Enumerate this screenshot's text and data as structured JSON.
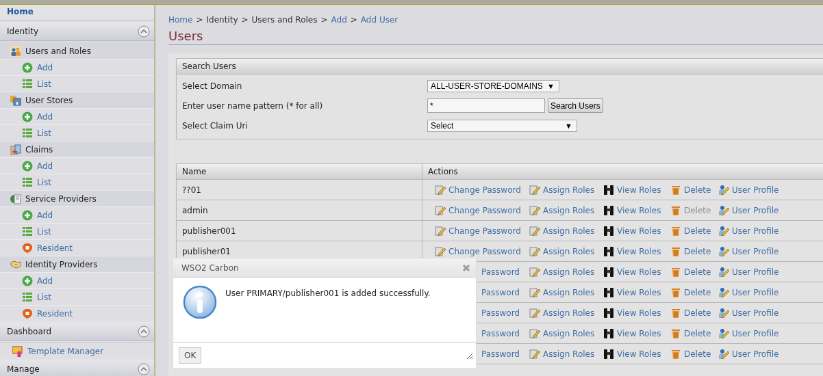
{
  "sidebar": {
    "home": "Home",
    "sections": [
      {
        "title": "Identity",
        "expanded": true,
        "items": [
          {
            "label": "Users and Roles",
            "kind": "users",
            "children": [
              {
                "label": "Add",
                "kind": "add"
              },
              {
                "label": "List",
                "kind": "list"
              }
            ]
          },
          {
            "label": "User Stores",
            "kind": "stores",
            "children": [
              {
                "label": "Add",
                "kind": "add"
              },
              {
                "label": "List",
                "kind": "list"
              }
            ]
          },
          {
            "label": "Claims",
            "kind": "claims",
            "children": [
              {
                "label": "Add",
                "kind": "add"
              },
              {
                "label": "List",
                "kind": "list"
              }
            ]
          },
          {
            "label": "Service Providers",
            "kind": "service-providers",
            "children": [
              {
                "label": "Add",
                "kind": "add"
              },
              {
                "label": "List",
                "kind": "list"
              },
              {
                "label": "Resident",
                "kind": "resident"
              }
            ]
          },
          {
            "label": "Identity Providers",
            "kind": "identity-providers",
            "children": [
              {
                "label": "Add",
                "kind": "add"
              },
              {
                "label": "List",
                "kind": "list"
              },
              {
                "label": "Resident",
                "kind": "resident"
              }
            ]
          }
        ]
      },
      {
        "title": "Dashboard",
        "expanded": true,
        "items": [
          {
            "label": "Template Manager",
            "kind": "template"
          }
        ]
      },
      {
        "title": "Manage",
        "expanded": true
      }
    ]
  },
  "breadcrumb": {
    "separator": ">",
    "items": [
      {
        "label": "Home",
        "link": true
      },
      {
        "label": "Identity",
        "link": false
      },
      {
        "label": "Users and Roles",
        "link": false
      },
      {
        "label": "Add",
        "link": true
      },
      {
        "label": "Add User",
        "link": true
      }
    ]
  },
  "title": "Users",
  "search": {
    "title": "Search Users",
    "fields": [
      {
        "label": "Select Domain",
        "kind": "select",
        "value": "ALL-USER-STORE-DOMAINS",
        "arrow": "▼"
      },
      {
        "label": "Enter user name pattern (* for all)",
        "kind": "text",
        "value": "*",
        "button": "Search Users"
      },
      {
        "label": "Select Claim Uri",
        "kind": "select-wide",
        "value": "Select",
        "arrow": "▼"
      }
    ]
  },
  "table": {
    "columns": [
      "Name",
      "Actions"
    ],
    "rows": [
      {
        "name": "??01",
        "actions": [
          {
            "kind": "change-password",
            "label": "Change Password",
            "disabled": false
          },
          {
            "kind": "assign-roles",
            "label": "Assign Roles",
            "disabled": false
          },
          {
            "kind": "view-roles",
            "label": "View Roles",
            "disabled": false
          },
          {
            "kind": "delete",
            "label": "Delete",
            "disabled": false
          },
          {
            "kind": "user-profile",
            "label": "User Profile",
            "disabled": false
          }
        ]
      },
      {
        "name": "admin",
        "actions": [
          {
            "kind": "change-password",
            "label": "Change Password",
            "disabled": false
          },
          {
            "kind": "assign-roles",
            "label": "Assign Roles",
            "disabled": false
          },
          {
            "kind": "view-roles",
            "label": "View Roles",
            "disabled": false
          },
          {
            "kind": "delete",
            "label": "Delete",
            "disabled": true
          },
          {
            "kind": "user-profile",
            "label": "User Profile",
            "disabled": false
          }
        ]
      },
      {
        "name": "publisher001",
        "actions": [
          {
            "kind": "change-password",
            "label": "Change Password",
            "disabled": false
          },
          {
            "kind": "assign-roles",
            "label": "Assign Roles",
            "disabled": false
          },
          {
            "kind": "view-roles",
            "label": "View Roles",
            "disabled": false
          },
          {
            "kind": "delete",
            "label": "Delete",
            "disabled": false
          },
          {
            "kind": "user-profile",
            "label": "User Profile",
            "disabled": false
          }
        ]
      },
      {
        "name": "publisher01",
        "actions": [
          {
            "kind": "change-password",
            "label": "Change Password",
            "disabled": false
          },
          {
            "kind": "assign-roles",
            "label": "Assign Roles",
            "disabled": false
          },
          {
            "kind": "view-roles",
            "label": "View Roles",
            "disabled": false
          },
          {
            "kind": "delete",
            "label": "Delete",
            "disabled": false
          },
          {
            "kind": "user-profile",
            "label": "User Profile",
            "disabled": false
          }
        ]
      },
      {
        "actions": [
          {
            "kind": "change-password-clipped",
            "label": "Password",
            "disabled": false
          },
          {
            "kind": "assign-roles",
            "label": "Assign Roles",
            "disabled": false
          },
          {
            "kind": "view-roles",
            "label": "View Roles",
            "disabled": false
          },
          {
            "kind": "delete",
            "label": "Delete",
            "disabled": false
          },
          {
            "kind": "user-profile",
            "label": "User Profile",
            "disabled": false
          }
        ]
      },
      {
        "actions": [
          {
            "kind": "change-password-clipped",
            "label": "Password",
            "disabled": false
          },
          {
            "kind": "assign-roles",
            "label": "Assign Roles",
            "disabled": false
          },
          {
            "kind": "view-roles",
            "label": "View Roles",
            "disabled": false
          },
          {
            "kind": "delete",
            "label": "Delete",
            "disabled": false
          },
          {
            "kind": "user-profile",
            "label": "User Profile",
            "disabled": false
          }
        ]
      },
      {
        "actions": [
          {
            "kind": "change-password-clipped",
            "label": "Password",
            "disabled": false
          },
          {
            "kind": "assign-roles",
            "label": "Assign Roles",
            "disabled": false
          },
          {
            "kind": "view-roles",
            "label": "View Roles",
            "disabled": false
          },
          {
            "kind": "delete",
            "label": "Delete",
            "disabled": false
          },
          {
            "kind": "user-profile",
            "label": "User Profile",
            "disabled": false
          }
        ]
      },
      {
        "actions": [
          {
            "kind": "change-password-clipped",
            "label": "Password",
            "disabled": false
          },
          {
            "kind": "assign-roles",
            "label": "Assign Roles",
            "disabled": false
          },
          {
            "kind": "view-roles",
            "label": "View Roles",
            "disabled": false
          },
          {
            "kind": "delete",
            "label": "Delete",
            "disabled": false
          },
          {
            "kind": "user-profile",
            "label": "User Profile",
            "disabled": false
          }
        ]
      },
      {
        "actions": [
          {
            "kind": "change-password-clipped",
            "label": "Password",
            "disabled": false
          },
          {
            "kind": "assign-roles",
            "label": "Assign Roles",
            "disabled": false
          },
          {
            "kind": "view-roles",
            "label": "View Roles",
            "disabled": false
          },
          {
            "kind": "delete",
            "label": "Delete",
            "disabled": false
          },
          {
            "kind": "user-profile",
            "label": "User Profile",
            "disabled": false
          }
        ]
      }
    ]
  },
  "dialog": {
    "title": "WSO2 Carbon",
    "message": "User PRIMARY/publisher001 is added successfully.",
    "button": "OK"
  }
}
